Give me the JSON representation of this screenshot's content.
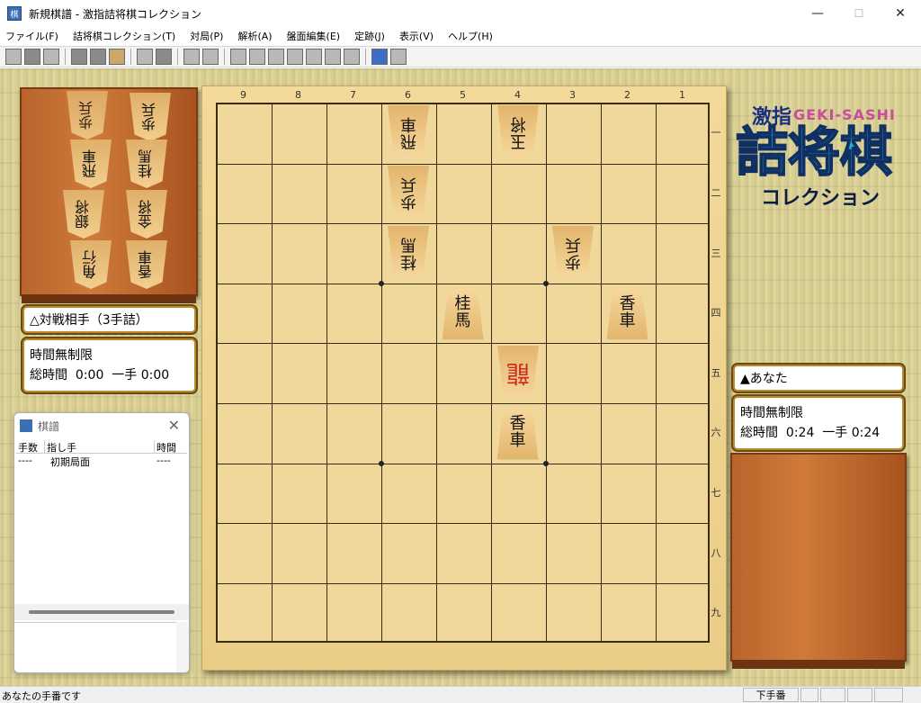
{
  "window": {
    "title": "新規棋譜 - 激指詰将棋コレクション",
    "icon": "shogi-app-icon",
    "min": "—",
    "max": "☐",
    "close": "✕"
  },
  "menu": [
    "ファイル(F)",
    "詰将棋コレクション(T)",
    "対局(P)",
    "解析(A)",
    "盤面編集(E)",
    "定跡(J)",
    "表示(V)",
    "ヘルプ(H)"
  ],
  "toolbar_icons": [
    "new-icon",
    "open-icon",
    "save-icon",
    "print-icon",
    "copy-icon",
    "paste-icon",
    "book-icon",
    "list-icon",
    "undo-move-icon",
    "redo-move-icon",
    "hint-icon",
    "hint2-icon",
    "first-icon",
    "back10-icon",
    "prev-icon",
    "stop-icon",
    "next-icon",
    "fwd10-icon",
    "last-icon",
    "board-view-icon",
    "help-icon"
  ],
  "board": {
    "files": [
      "9",
      "8",
      "7",
      "6",
      "5",
      "4",
      "3",
      "2",
      "1"
    ],
    "ranks": [
      "一",
      "二",
      "三",
      "四",
      "五",
      "六",
      "七",
      "八",
      "九"
    ],
    "pieces": [
      {
        "file": 6,
        "rank": 1,
        "label": "飛車",
        "owner": "gote",
        "promoted": false
      },
      {
        "file": 4,
        "rank": 1,
        "label": "玉将",
        "owner": "gote",
        "promoted": false
      },
      {
        "file": 6,
        "rank": 2,
        "label": "歩兵",
        "owner": "gote",
        "promoted": false
      },
      {
        "file": 6,
        "rank": 3,
        "label": "桂馬",
        "owner": "gote",
        "promoted": false
      },
      {
        "file": 3,
        "rank": 3,
        "label": "歩兵",
        "owner": "gote",
        "promoted": false
      },
      {
        "file": 5,
        "rank": 4,
        "label": "桂馬",
        "owner": "sente",
        "promoted": false
      },
      {
        "file": 2,
        "rank": 4,
        "label": "香車",
        "owner": "sente",
        "promoted": false
      },
      {
        "file": 4,
        "rank": 5,
        "label": "龍",
        "owner": "gote",
        "promoted": true
      },
      {
        "file": 4,
        "rank": 6,
        "label": "香車",
        "owner": "sente",
        "promoted": false
      }
    ]
  },
  "gote_hand": [
    {
      "label": "歩兵"
    },
    {
      "label": "飛車"
    },
    {
      "label": "桂馬"
    },
    {
      "label": "銀将"
    },
    {
      "label": "金将"
    },
    {
      "label": "角行"
    },
    {
      "label": "香車"
    }
  ],
  "opponent": {
    "name": "△対戦相手（3手詰）",
    "time_mode": "時間無制限",
    "total_label": "総時間",
    "total": "0:00",
    "move_label": "一手",
    "move": "0:00"
  },
  "player": {
    "name": "▲あなた",
    "time_mode": "時間無制限",
    "total_label": "総時間",
    "total": "0:24",
    "move_label": "一手",
    "move": "0:24"
  },
  "logo": {
    "top": "激指",
    "roman": "GEKI-SASHI",
    "main": "詰将棋",
    "sub": "コレクション"
  },
  "kifu": {
    "title": "棋譜",
    "headers": [
      "手数",
      "指し手",
      "時間"
    ],
    "rows": [
      {
        "num": "----",
        "move": "初期局面",
        "time": "----"
      }
    ]
  },
  "status": {
    "message": "あなたの手番です",
    "turn": "下手番"
  },
  "colors": {
    "promoted": "#d0281f",
    "panel_border": "#b98a2e",
    "tatami": "#d7cf95"
  }
}
